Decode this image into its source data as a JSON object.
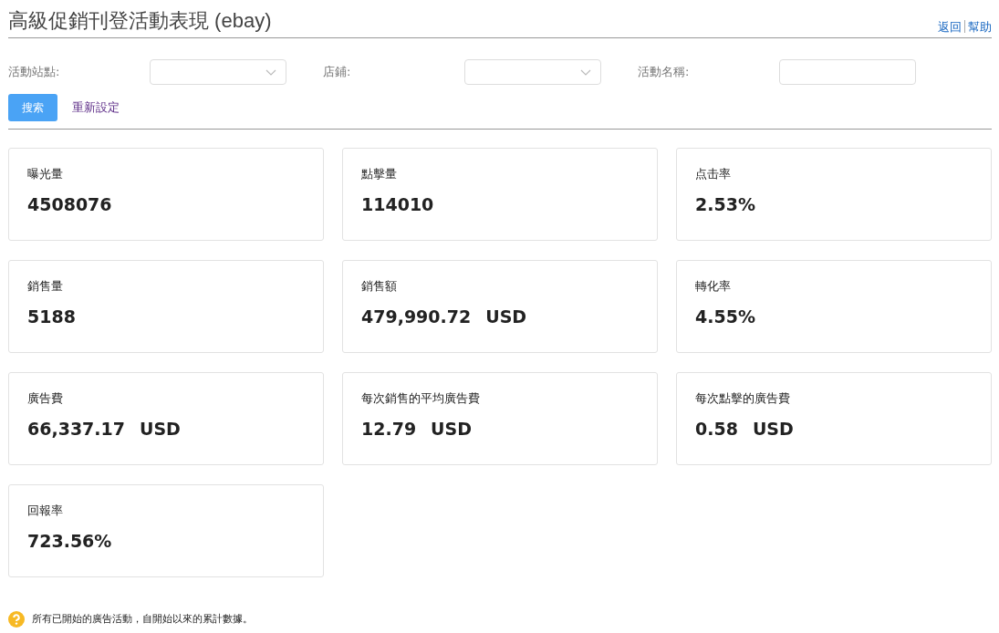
{
  "title": "高級促銷刊登活動表現 (ebay)",
  "header_links": [
    "返回",
    "幫助"
  ],
  "filters": [
    {
      "label": "活動站點:",
      "kind": "select"
    },
    {
      "label": "店鋪:",
      "kind": "select"
    },
    {
      "label": "活動名稱:",
      "kind": "text"
    }
  ],
  "search_button": "搜索",
  "reset_link": "重新設定",
  "metrics": [
    {
      "label": "曝光量",
      "value": "4508076"
    },
    {
      "label": "點擊量",
      "value": "114010"
    },
    {
      "label": "点击率",
      "value": "2.53%"
    },
    {
      "label": "銷售量",
      "value": "5188"
    },
    {
      "label": "銷售額",
      "value": "479,990.72",
      "unit": "USD"
    },
    {
      "label": "轉化率",
      "value": "4.55%"
    },
    {
      "label": "廣告費",
      "value": "66,337.17",
      "unit": "USD"
    },
    {
      "label": "每次銷售的平均廣告費",
      "value": "12.79",
      "unit": "USD"
    },
    {
      "label": "每次點擊的廣告費",
      "value": "0.58",
      "unit": "USD"
    },
    {
      "label": "回報率",
      "value": "723.56%"
    }
  ],
  "footnote": "所有已開始的廣告活動，自開始以來的累計數據。"
}
